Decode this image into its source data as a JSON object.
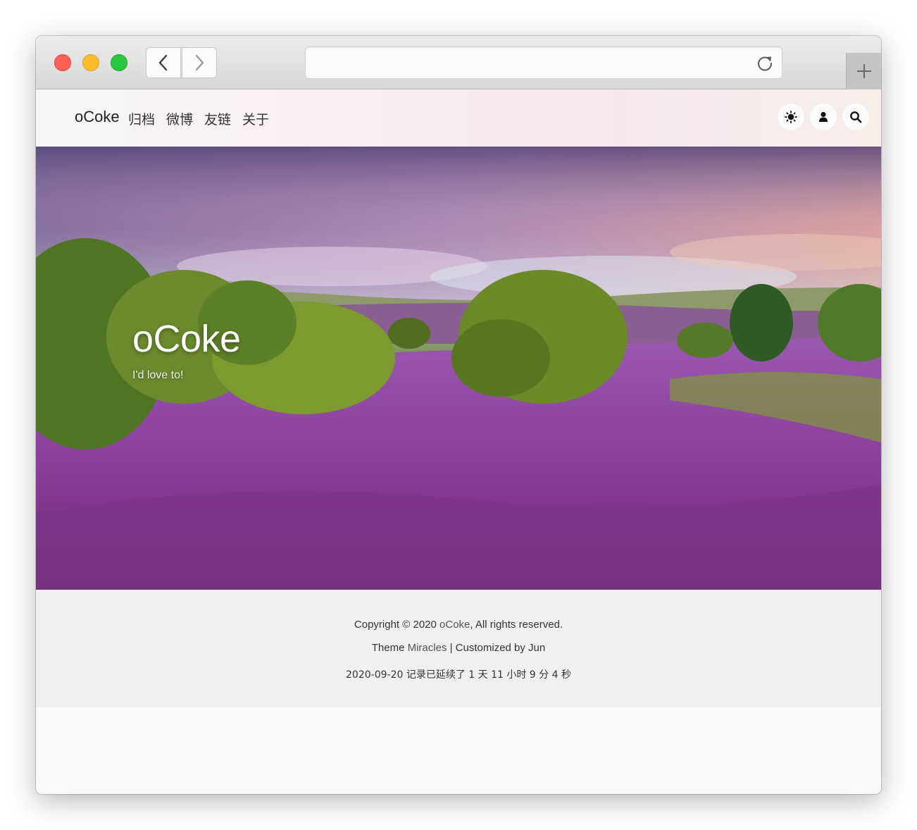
{
  "browser": {
    "url": "",
    "icons": {
      "back": "chevron-left-icon",
      "forward": "chevron-right-icon",
      "reload": "reload-icon",
      "new_tab": "plus-icon"
    }
  },
  "site": {
    "brand": "oCoke",
    "nav": [
      {
        "label": "归档"
      },
      {
        "label": "微博"
      },
      {
        "label": "友链"
      },
      {
        "label": "关于"
      }
    ],
    "header_icons": [
      "theme-toggle-icon",
      "user-icon",
      "search-icon"
    ]
  },
  "hero": {
    "title": "oCoke",
    "subtitle": "I'd love to!"
  },
  "footer": {
    "copyright_prefix": "Copyright © 2020 ",
    "copyright_link": "oCoke",
    "copyright_suffix": ", All rights reserved.",
    "theme_prefix": "Theme ",
    "theme_link": "Miracles",
    "theme_suffix": " | Customized by Jun",
    "uptime": "2020-09-20 记录已延续了 1 天 11 小时 9 分 4 秒"
  },
  "colors": {
    "close": "#fe5f57",
    "minimize": "#febc2e",
    "maximize": "#28c840",
    "footer_bg": "#f0f0f0"
  }
}
